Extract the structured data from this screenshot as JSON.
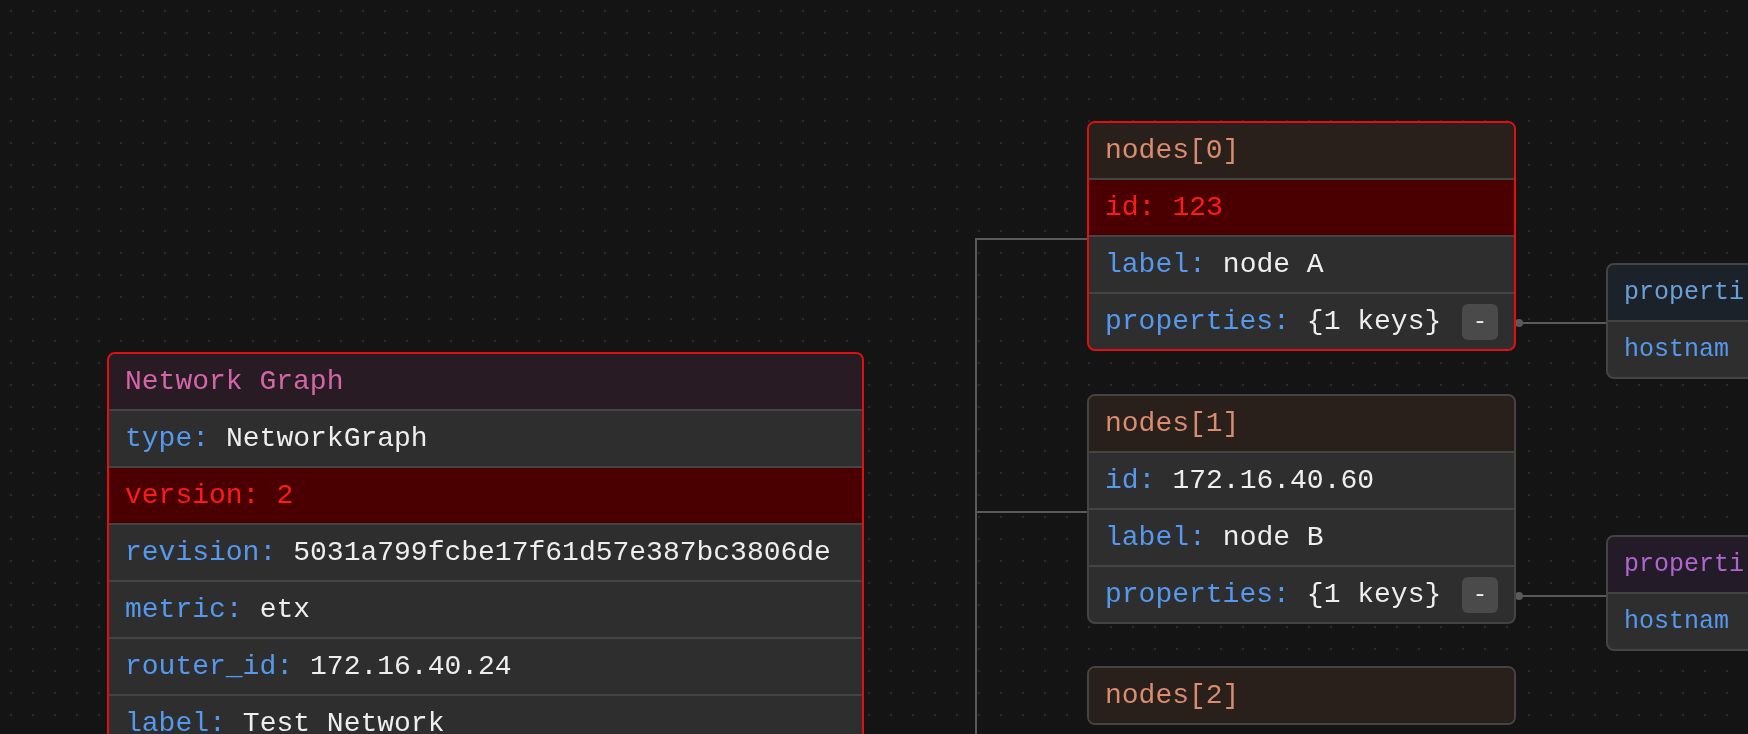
{
  "cards": [
    {
      "title": "Network Graph",
      "color": "#d466a8",
      "selected": true,
      "rows": [
        {
          "key": "type:",
          "value": "NetworkGraph",
          "error": false
        },
        {
          "key": "version:",
          "value": "2",
          "error": true
        },
        {
          "key": "revision:",
          "value": "5031a799fcbe17f61d57e387bc3806de",
          "error": false
        },
        {
          "key": "metric:",
          "value": "etx",
          "error": false
        },
        {
          "key": "router_id:",
          "value": "172.16.40.24",
          "error": false
        },
        {
          "key": "label:",
          "value": "Test Network",
          "error": false
        }
      ]
    },
    {
      "title": "nodes[0]",
      "color": "#d98c6e",
      "selected": true,
      "rows": [
        {
          "key": "id:",
          "value": "123",
          "error": true
        },
        {
          "key": "label:",
          "value": "node A",
          "error": false
        },
        {
          "key": "properties:",
          "value": "{1 keys}",
          "error": false,
          "toggle": "-"
        }
      ]
    },
    {
      "title": "nodes[1]",
      "color": "#d98c6e",
      "selected": false,
      "rows": [
        {
          "key": "id:",
          "value": "172.16.40.60",
          "error": false
        },
        {
          "key": "label:",
          "value": "node B",
          "error": false
        },
        {
          "key": "properties:",
          "value": "{1 keys}",
          "error": false,
          "toggle": "-"
        }
      ]
    },
    {
      "title": "nodes[2]",
      "color": "#d98c6e",
      "selected": false
    },
    {
      "title": "properti",
      "color": "#6a9fd8",
      "selected": false,
      "rows": [
        {
          "key": "hostnam",
          "error": false
        }
      ]
    },
    {
      "title": "properti",
      "color": "#b066d0",
      "selected": false,
      "rows": [
        {
          "key": "hostnam",
          "error": false
        }
      ]
    }
  ]
}
